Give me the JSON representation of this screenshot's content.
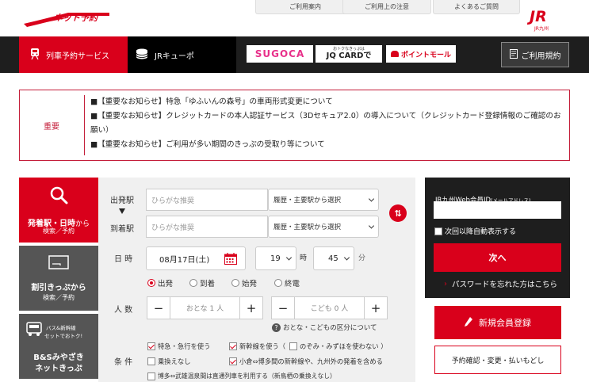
{
  "header": {
    "logo_text": "ネット予約",
    "jr_logo_text": "JR",
    "jr_logo_sub": "JR九州",
    "links": [
      "ご利用案内",
      "ご利用上の注意",
      "よくあるご質問"
    ]
  },
  "nav": {
    "rail_service": "列車予約サービス",
    "jr_cue": "JRキューポ",
    "sugoca": "SUGOCA",
    "jq_small": "おトクなきっぷは",
    "jq_big": "JQ CARDで",
    "point_mall": "ポイントモール",
    "terms": "ご利用規約"
  },
  "notice": {
    "label": "重要",
    "items": [
      "■【重要なお知らせ】特急「ゆふいんの森号」の車両形式変更について",
      "■【重要なお知らせ】クレジットカードの本人認証サービス（3Dセキュア2.0）の導入について（クレジットカード登録情報のご確認のお願い）",
      "■【重要なお知らせ】ご利用が多い期間のきっぷの受取り等について"
    ]
  },
  "left_menu": {
    "station_time_a": "発着駅・日時",
    "station_time_b": "から",
    "station_time_sub": "検索／予約",
    "discount": "割引きっぷから",
    "discount_sub": "検索／予約",
    "bs_badge_1": "バス&新幹線",
    "bs_badge_2": "セットでおトク!",
    "bs_title_1": "B&Sみやざき",
    "bs_title_2": "ネットきっぷ"
  },
  "form": {
    "departure_label": "出発駅",
    "arrival_label": "到着駅",
    "departure_placeholder": "ひらがな推奨",
    "arrival_placeholder": "ひらがな推奨",
    "history_select": "履歴・主要駅から選択",
    "swap_icon": "⇅",
    "datetime_label": "日 時",
    "date_value": "08月17日(土)",
    "hour_value": "19",
    "hour_unit": "時",
    "minute_value": "45",
    "minute_unit": "分",
    "time_options": [
      "出発",
      "到着",
      "始発",
      "終電"
    ],
    "people_label": "人 数",
    "adult": "おとな 1 人",
    "child": "こども 0 人",
    "minus": "−",
    "plus": "+",
    "age_note": "おとな・こどもの区分について",
    "conditions_label": "条 件",
    "conditions": {
      "limited_express": "特急・急行を使う",
      "shinkansen": "新幹線を使う（",
      "no_nozomi": "のぞみ・みずほを使わない ）",
      "no_transfer": "乗換えなし",
      "kokura": "小倉⇔博多間の新幹線や、九州外の発着を含める",
      "takeo": "博多⇔武雄温泉間は直通列車を利用する（新鳥栖の乗換えなし）"
    }
  },
  "login": {
    "id_label": "JR九州Web会員ID",
    "id_label_small": "(メールアドレス)",
    "auto_display": "次回以降自動表示する",
    "next": "次へ",
    "forgot": "パスワードを忘れた方はこちら",
    "register": "新規会員登録",
    "reservation": "予約確認・変更・払いもどし"
  },
  "colors": {
    "brand_red": "#d9001b",
    "dark": "#1e1e1e"
  }
}
